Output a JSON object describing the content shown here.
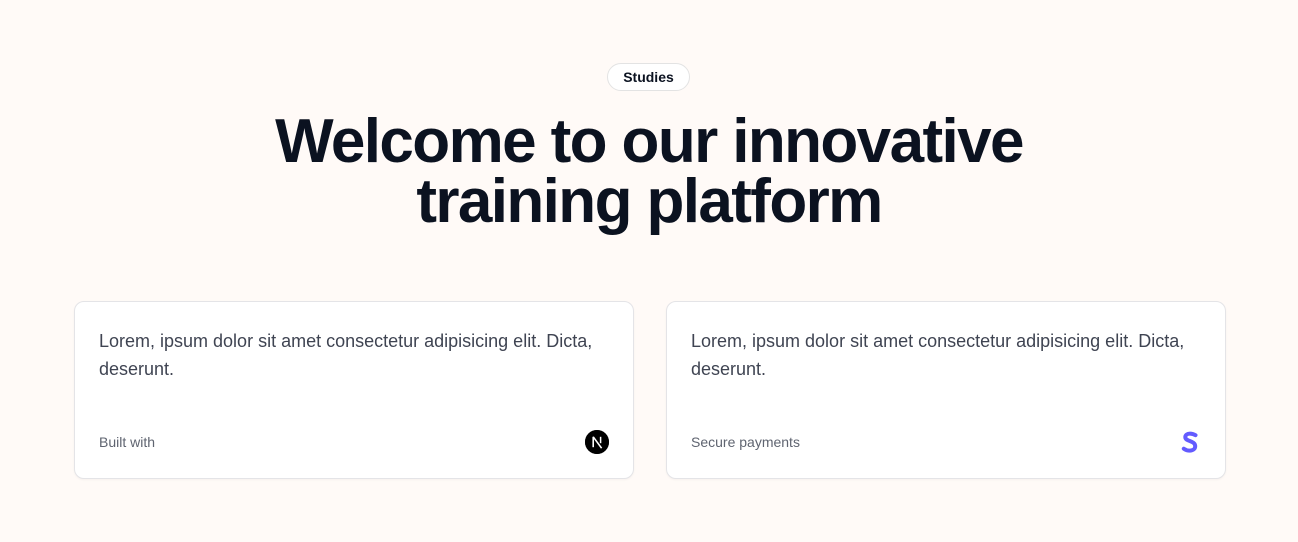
{
  "badge": {
    "label": "Studies"
  },
  "hero": {
    "line1": "Welcome to our innovative",
    "line2": "training platform"
  },
  "cards": [
    {
      "text": "Lorem, ipsum dolor sit amet consectetur adipisicing elit. Dicta, deserunt.",
      "footer_label": "Built with",
      "logo_icon": "nextjs-logo-icon",
      "logo_glyph": "N"
    },
    {
      "text": "Lorem, ipsum dolor sit amet consectetur adipisicing elit. Dicta, deserunt.",
      "footer_label": "Secure payments",
      "logo_icon": "stripe-logo-icon",
      "logo_glyph": "S"
    }
  ],
  "colors": {
    "background": "#fffaf7",
    "heading": "#0b1220",
    "body_text": "#3f4452",
    "stripe": "#635bff"
  }
}
